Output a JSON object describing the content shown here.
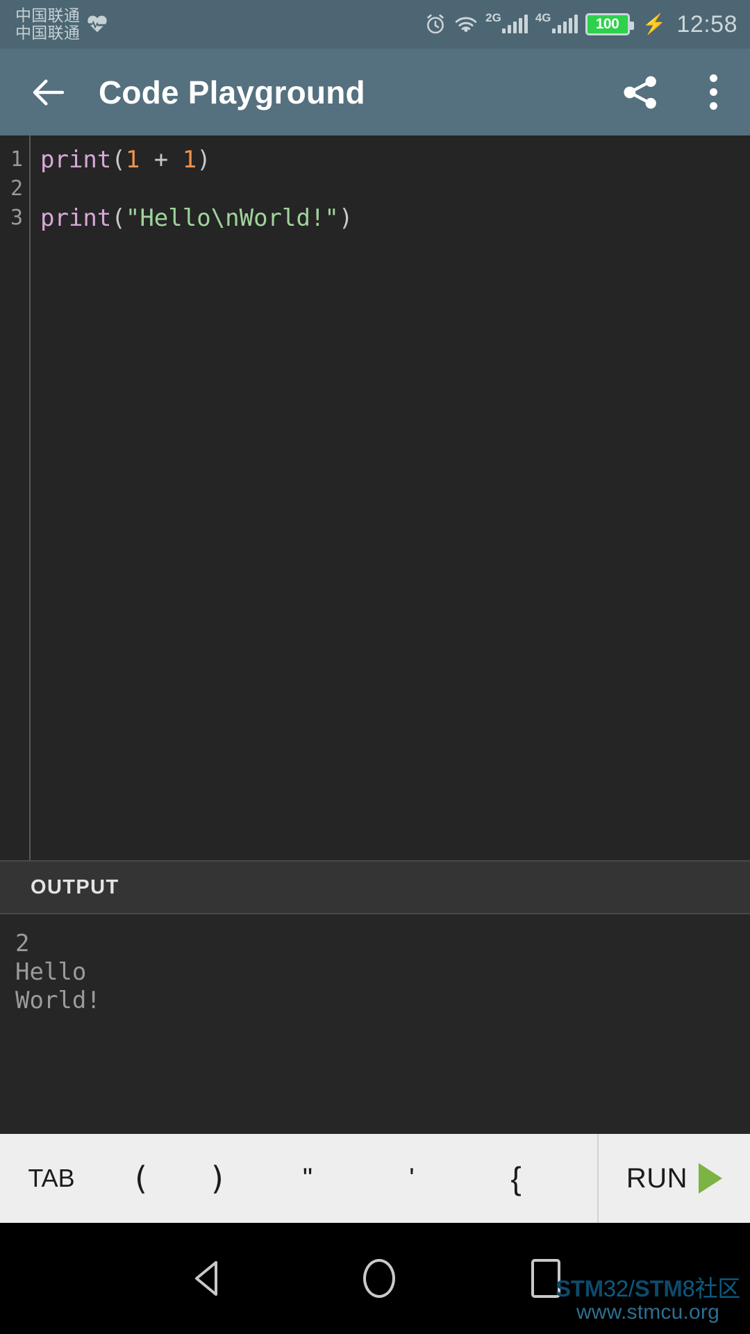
{
  "status_bar": {
    "carrier_primary": "中国联通",
    "carrier_secondary": "中国联通",
    "health_icon": "heart-rate-icon",
    "alarm_icon": "alarm-clock-icon",
    "wifi_icon": "wifi-icon",
    "network_2g_label": "2G",
    "network_4g_label": "4G",
    "battery_level": "100",
    "charging_icon": "lightning-bolt-icon",
    "time": "12:58"
  },
  "app_bar": {
    "back_icon": "back-arrow-icon",
    "title": "Code Playground",
    "share_icon": "share-icon",
    "overflow_icon": "overflow-menu-icon"
  },
  "editor": {
    "line_numbers": [
      "1",
      "2",
      "3"
    ],
    "lines": [
      {
        "number": "1",
        "tokens": [
          {
            "text": "print",
            "type": "fn"
          },
          {
            "text": "(",
            "type": "punct"
          },
          {
            "text": "1",
            "type": "num"
          },
          {
            "text": " + ",
            "type": "op"
          },
          {
            "text": "1",
            "type": "num"
          },
          {
            "text": ")",
            "type": "punct"
          }
        ]
      },
      {
        "number": "2",
        "tokens": []
      },
      {
        "number": "3",
        "tokens": [
          {
            "text": "print",
            "type": "fn"
          },
          {
            "text": "(",
            "type": "punct"
          },
          {
            "text": "\"Hello\\nWorld!\"",
            "type": "str"
          },
          {
            "text": ")",
            "type": "punct"
          }
        ]
      }
    ],
    "plain_source": "print(1 + 1)\n\nprint(\"Hello\\nWorld!\")"
  },
  "output_panel": {
    "header_label": "OUTPUT",
    "lines": [
      "2",
      "Hello",
      "World!"
    ]
  },
  "key_toolbar": {
    "keys": [
      {
        "label": "TAB",
        "name": "key-tab"
      },
      {
        "label": "(",
        "name": "key-open-paren"
      },
      {
        "label": ")",
        "name": "key-close-paren"
      },
      {
        "label": "\"",
        "name": "key-double-quote"
      },
      {
        "label": "'",
        "name": "key-single-quote"
      },
      {
        "label": "{",
        "name": "key-open-brace"
      }
    ],
    "run_label": "RUN",
    "run_icon": "play-triangle-icon"
  },
  "nav_bar": {
    "back_icon": "nav-back-icon",
    "home_icon": "nav-home-icon",
    "recents_icon": "nav-recents-icon"
  },
  "watermark": {
    "line1_a": "STM",
    "line1_b": "32/",
    "line1_c": "STM",
    "line1_d": "8社区",
    "line2": "www.stmcu.org"
  },
  "colors": {
    "status_bar_bg": "#4c6673",
    "app_bar_bg": "#55707e",
    "editor_bg": "#252525",
    "output_header_bg": "#343434",
    "output_body_bg": "#262626",
    "keybar_bg": "#eeeeee",
    "run_green": "#7cb342",
    "battery_green": "#2dd14b",
    "token_function": "#d9a7d9",
    "token_number": "#f0914a",
    "token_string": "#9fd49b",
    "token_punctuation": "#c8c8c8",
    "watermark_blue": "#0d5b82"
  }
}
